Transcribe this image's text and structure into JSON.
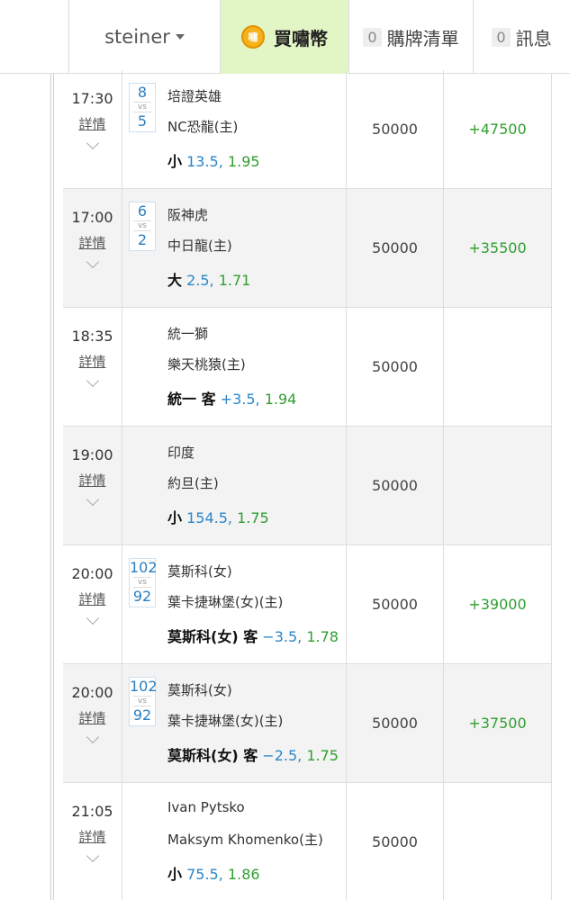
{
  "header": {
    "username": "steiner",
    "buy_label": "買嘯幣",
    "coin_glyph": "嘯",
    "cart_count": "0",
    "cart_label": "購牌清單",
    "msg_count": "0",
    "msg_label": "訊息"
  },
  "detail_label": "詳情",
  "vs_label": "vs",
  "rows": [
    {
      "time": "17:30",
      "score_away": "8",
      "score_home": "5",
      "team_away": "培證英雄",
      "team_home": "NC恐龍(主)",
      "pick": "小",
      "line": "13.5,",
      "odds": "1.95",
      "stake": "50000",
      "win": "+47500"
    },
    {
      "time": "17:00",
      "score_away": "6",
      "score_home": "2",
      "team_away": "阪神虎",
      "team_home": "中日龍(主)",
      "pick": "大",
      "line": "2.5,",
      "odds": "1.71",
      "stake": "50000",
      "win": "+35500"
    },
    {
      "time": "18:35",
      "score_away": "",
      "score_home": "",
      "team_away": "統一獅",
      "team_home": "樂天桃猿(主)",
      "pick": "統一 客",
      "line": "+3.5,",
      "odds": "1.94",
      "stake": "50000",
      "win": ""
    },
    {
      "time": "19:00",
      "score_away": "",
      "score_home": "",
      "team_away": "印度",
      "team_home": "約旦(主)",
      "pick": "小",
      "line": "154.5,",
      "odds": "1.75",
      "stake": "50000",
      "win": ""
    },
    {
      "time": "20:00",
      "score_away": "102",
      "score_home": "92",
      "team_away": "莫斯科(女)",
      "team_home": "葉卡捷琳堡(女)(主)",
      "pick": "莫斯科(女) 客",
      "line": "−3.5,",
      "odds": "1.78",
      "stake": "50000",
      "win": "+39000"
    },
    {
      "time": "20:00",
      "score_away": "102",
      "score_home": "92",
      "team_away": "莫斯科(女)",
      "team_home": "葉卡捷琳堡(女)(主)",
      "pick": "莫斯科(女) 客",
      "line": "−2.5,",
      "odds": "1.75",
      "stake": "50000",
      "win": "+37500"
    },
    {
      "time": "21:05",
      "score_away": "",
      "score_home": "",
      "team_away": "Ivan Pytsko",
      "team_home": "Maksym Khomenko(主)",
      "pick": "小",
      "line": "75.5,",
      "odds": "1.86",
      "stake": "50000",
      "win": ""
    }
  ]
}
